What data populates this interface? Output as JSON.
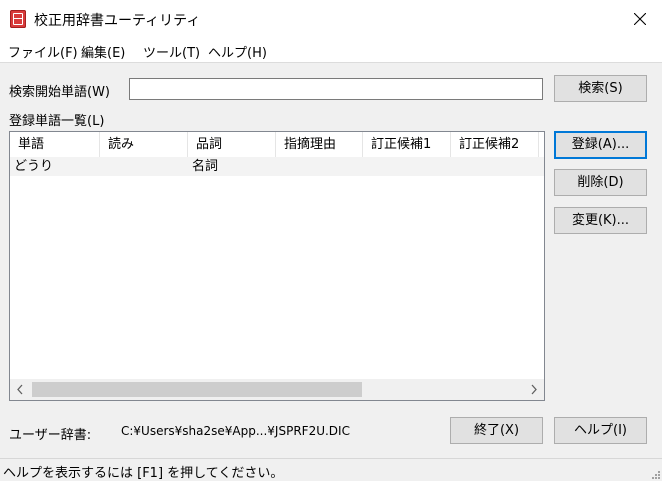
{
  "window": {
    "title": "校正用辞書ユーティリティ",
    "close_glyph": "✕"
  },
  "menu": {
    "items": [
      "ファイル(F)",
      "編集(E)",
      "ツール(T)",
      "ヘルプ(H)"
    ]
  },
  "search": {
    "label": "検索開始単語(W)",
    "value": "",
    "button": "検索(S)"
  },
  "list": {
    "label": "登録単語一覧(L)",
    "columns": [
      "単語",
      "読み",
      "品詞",
      "指摘理由",
      "訂正候補1",
      "訂正候補2"
    ],
    "rows": [
      [
        "どうり",
        "",
        "名詞",
        "",
        "",
        ""
      ]
    ]
  },
  "buttons": {
    "register": "登録(A)...",
    "delete": "削除(D)",
    "change": "変更(K)...",
    "exit": "終了(X)",
    "help": "ヘルプ(I)"
  },
  "user_dict": {
    "label": "ユーザー辞書:",
    "path": "C:¥Users¥sha2se¥App...¥JSPRF2U.DIC"
  },
  "status": {
    "text": "ヘルプを表示するには [F1] を押してください。"
  },
  "colors": {
    "accent": "#0078d7",
    "icon": "#d83b3b"
  }
}
